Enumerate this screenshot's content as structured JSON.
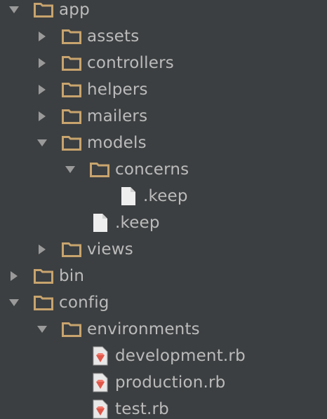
{
  "tree": {
    "items": [
      {
        "label": "app",
        "type": "folder",
        "state": "expanded",
        "depth": 0
      },
      {
        "label": "assets",
        "type": "folder",
        "state": "collapsed",
        "depth": 1
      },
      {
        "label": "controllers",
        "type": "folder",
        "state": "collapsed",
        "depth": 1
      },
      {
        "label": "helpers",
        "type": "folder",
        "state": "collapsed",
        "depth": 1
      },
      {
        "label": "mailers",
        "type": "folder",
        "state": "collapsed",
        "depth": 1
      },
      {
        "label": "models",
        "type": "folder",
        "state": "expanded",
        "depth": 1
      },
      {
        "label": "concerns",
        "type": "folder",
        "state": "expanded",
        "depth": 2
      },
      {
        "label": ".keep",
        "type": "file",
        "depth": 3
      },
      {
        "label": ".keep",
        "type": "file",
        "depth": 2
      },
      {
        "label": "views",
        "type": "folder",
        "state": "collapsed",
        "depth": 1
      },
      {
        "label": "bin",
        "type": "folder",
        "state": "collapsed",
        "depth": 0
      },
      {
        "label": "config",
        "type": "folder",
        "state": "expanded",
        "depth": 0
      },
      {
        "label": "environments",
        "type": "folder",
        "state": "expanded",
        "depth": 1
      },
      {
        "label": "development.rb",
        "type": "ruby-file",
        "depth": 2
      },
      {
        "label": "production.rb",
        "type": "ruby-file",
        "depth": 2
      },
      {
        "label": "test.rb",
        "type": "ruby-file",
        "depth": 2
      }
    ]
  },
  "colors": {
    "background": "#3c3f41",
    "text": "#bbbbbb",
    "folder": "#c8a46e",
    "arrow": "#9a9a9a",
    "file": "#eeeeee",
    "ruby": "#e0574a"
  },
  "icons": {
    "expanded": "triangle-down-icon",
    "collapsed": "triangle-right-icon",
    "folder": "folder-icon",
    "file": "file-icon",
    "ruby-file": "ruby-file-icon"
  }
}
